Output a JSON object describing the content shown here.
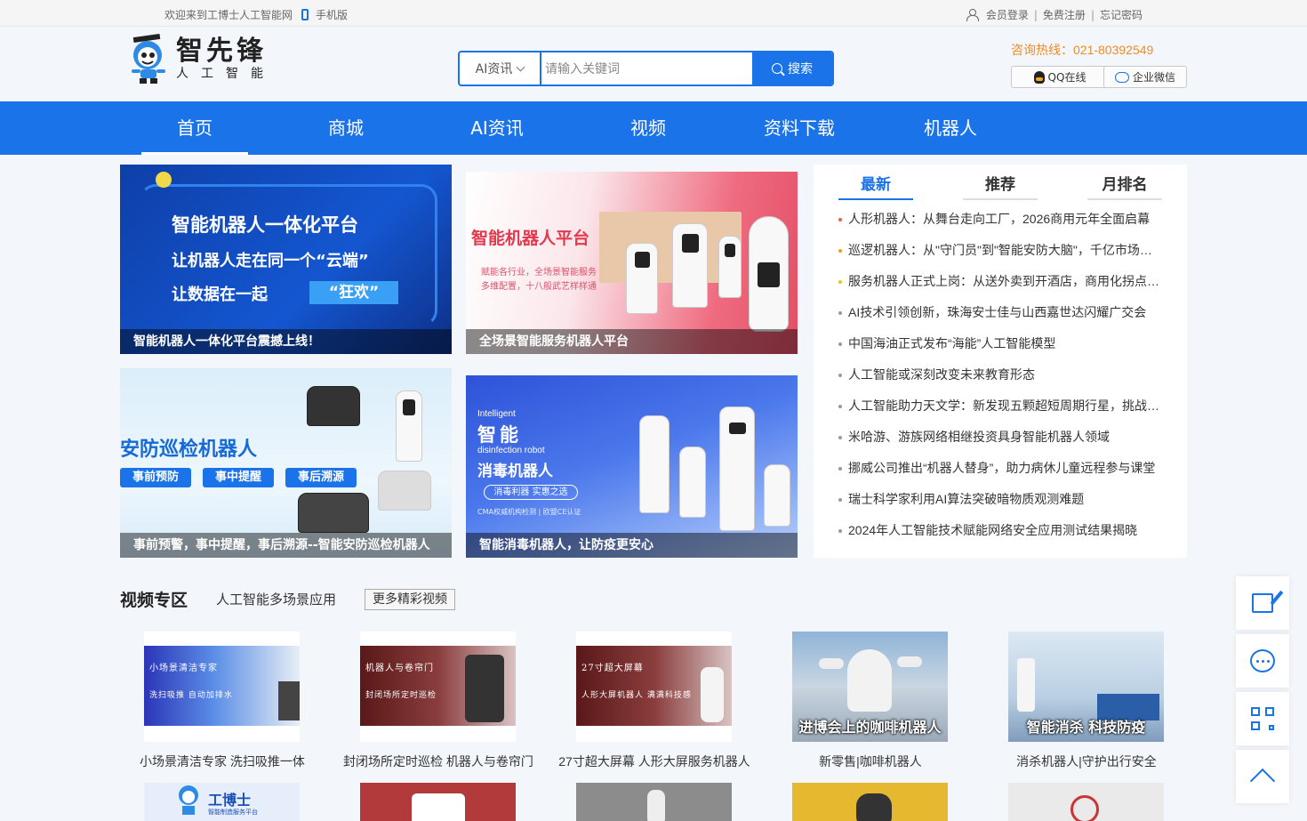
{
  "topbar": {
    "welcome": "欢迎来到工博士人工智能网",
    "mobile": "手机版",
    "login": "会员登录",
    "register": "免费注册",
    "forgot": "忘记密码",
    "sep": "|"
  },
  "logo": {
    "big": "智先锋",
    "small": "人工智能"
  },
  "search": {
    "category": "AI资讯",
    "placeholder": "请输入关键词",
    "button": "搜索"
  },
  "contact": {
    "hotline": "咨询热线：021-80392549",
    "qq": "QQ在线",
    "wechat": "企业微信"
  },
  "nav": [
    "首页",
    "商城",
    "AI资讯",
    "视频",
    "资料下载",
    "机器人"
  ],
  "banners": [
    {
      "caption": "智能机器人一体化平台震撼上线！",
      "line1": "智能机器人一体化平台",
      "line2": "让机器人走在同一个“云端”",
      "line3": "让数据在一起",
      "highlight": "“狂欢”"
    },
    {
      "caption": "全场景智能服务机器人平台",
      "title": "智能机器人平台",
      "sub1": "赋能各行业，全场景智能服务",
      "sub2": "多维配置，十八般武艺样样通"
    },
    {
      "caption": "事前预警，事中提醒，事后溯源--智能安防巡检机器人",
      "title": "安防巡检机器人",
      "pills": [
        "事前预防",
        "事中提醒",
        "事后溯源"
      ]
    },
    {
      "caption": "智能消毒机器人，让防疫更安心",
      "en1": "Intelligent",
      "zh1": "智能",
      "en2": "disinfection robot",
      "zh2": "消毒机器人",
      "pill": "消毒利器  实惠之选",
      "cert": "CMA权威机构检测 | 欧盟CE认证"
    }
  ],
  "news": {
    "tabs": [
      "最新",
      "推荐",
      "月排名"
    ],
    "items": [
      "人形机器人：从舞台走向工厂，2026商用元年全面启幕",
      "巡逻机器人：从\"守门员\"到\"智能安防大脑\"，千亿市场正在爆发",
      "服务机器人正式上岗：从送外卖到开酒店，商用化拐点已至",
      "AI技术引领创新，珠海安士佳与山西嘉世达闪耀广交会",
      "中国海油正式发布“海能”人工智能模型",
      "人工智能或深刻改变未来教育形态",
      "人工智能助力天文学：新发现五颗超短周期行星，挑战现有理论",
      "米哈游、游族网络相继投资具身智能机器人领域",
      "挪威公司推出“机器人替身”，助力病休儿童远程参与课堂",
      "瑞士科学家利用AI算法突破暗物质观测难题",
      "2024年人工智能技术赋能网络安全应用测试结果揭晓"
    ]
  },
  "video": {
    "title": "视频专区",
    "subtitle": "人工智能多场景应用",
    "more": "更多精彩视频",
    "cards": [
      {
        "caption": "小场景清洁专家 洗扫吸推一体",
        "t1": "小场景清洁专家",
        "t2": "洗扫吸推  自动加排水"
      },
      {
        "caption": "封闭场所定时巡检 机器人与卷帘门",
        "t1": "机器人与卷帘门",
        "t2": "封闭场所定时巡检"
      },
      {
        "caption": "27寸超大屏幕 人形大屏服务机器人",
        "t1": "27寸超大屏幕",
        "t2": "人形大屏机器人  满满科技感"
      },
      {
        "caption": "新零售|咖啡机器人",
        "overlay": "进博会上的咖啡机器人"
      },
      {
        "caption": "消杀机器人|守护出行安全",
        "overlay": "智能消杀  科技防疫"
      }
    ],
    "row2_logo": "工博士",
    "row2_logo_sub": "智能制造服务平台"
  },
  "colors": {
    "primary": "#1a73e8",
    "hotline": "#ef8b26"
  }
}
